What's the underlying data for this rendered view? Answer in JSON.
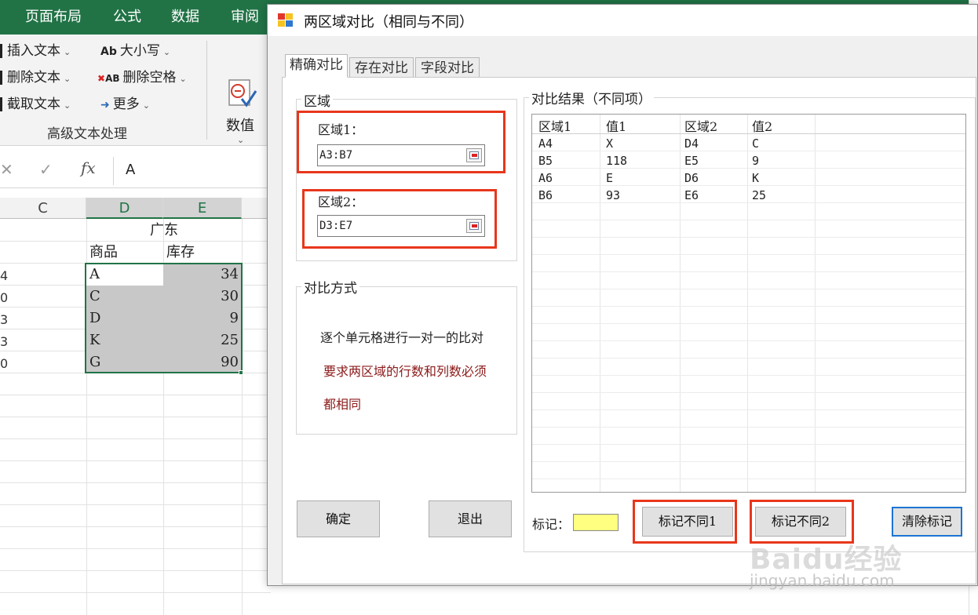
{
  "excel": {
    "ribbon_tabs": [
      "页面布局",
      "公式",
      "数据",
      "审阅"
    ],
    "text_group": {
      "insert_text": "插入文本",
      "delete_text": "删除文本",
      "extract_text": "截取文本",
      "change_case": "大小写",
      "change_case_icon_text": "Ab",
      "delete_spaces": "删除空格",
      "delete_spaces_icon_text": "AB",
      "more": "更多",
      "group_label": "高级文本处理"
    },
    "number_button": "数值",
    "formula_value": "A",
    "columns": [
      "C",
      "D",
      "E"
    ],
    "row_numbers_partial": [
      "4",
      "0",
      "3",
      "3",
      "0"
    ],
    "header_title": "广东",
    "headers": [
      "商品",
      "库存"
    ],
    "rows": [
      {
        "product": "A",
        "stock": "34"
      },
      {
        "product": "C",
        "stock": "30"
      },
      {
        "product": "D",
        "stock": "9"
      },
      {
        "product": "K",
        "stock": "25"
      },
      {
        "product": "G",
        "stock": "90"
      }
    ]
  },
  "dialog": {
    "title": "两区域对比（相同与不同）",
    "tabs": [
      "精确对比",
      "存在对比",
      "字段对比"
    ],
    "region_group": "区域",
    "region1_label": "区域1：",
    "region1_value": "A3:B7",
    "region2_label": "区域2：",
    "region2_value": "D3:E7",
    "method_group": "对比方式",
    "method_line1": "逐个单元格进行一对一的比对",
    "method_line2": "要求两区域的行数和列数必须",
    "method_line3": "都相同",
    "method_warning_color": "#8b1a1a",
    "confirm_button": "确定",
    "exit_button": "退出",
    "result_group": "对比结果（不同项）",
    "result_columns": [
      "区域1",
      "值1",
      "区域2",
      "值2"
    ],
    "result_rows": [
      [
        "A4",
        "X",
        "D4",
        "C"
      ],
      [
        "B5",
        "118",
        "E5",
        "9"
      ],
      [
        "A6",
        "E",
        "D6",
        "K"
      ],
      [
        "B6",
        "93",
        "E6",
        "25"
      ]
    ],
    "mark_label": "标记：",
    "mark_color": "#ffff80",
    "mark_diff1_button": "标记不同1",
    "mark_diff2_button": "标记不同2",
    "clear_marks_button": "清除标记"
  },
  "watermark": {
    "main": "Baidu经验",
    "sub": "jingyan.baidu.com"
  },
  "colors": {
    "excel_green": "#217346",
    "highlight_red": "#e8361c",
    "focus_blue": "#1c74d2"
  }
}
